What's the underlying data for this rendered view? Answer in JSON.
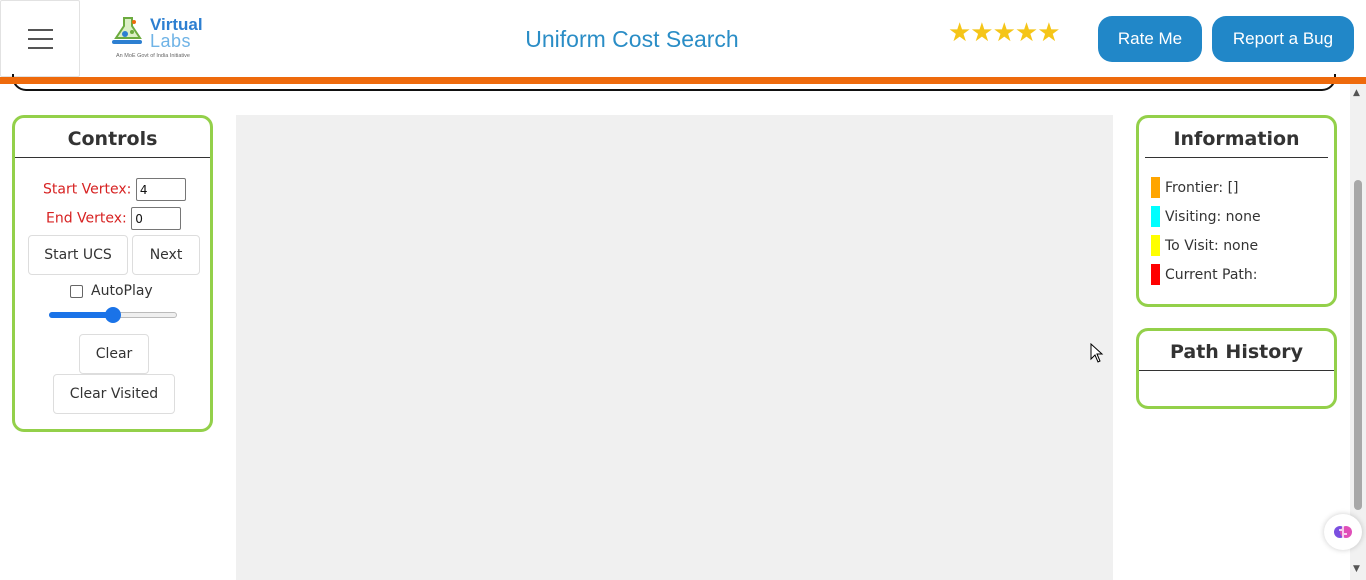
{
  "header": {
    "logo_text": "Virtual",
    "logo_text2": "Labs",
    "logo_tagline": "An MoE Govt of India Initiative",
    "title": "Uniform Cost Search",
    "stars": "★★★★★",
    "rate_label": "Rate Me",
    "bug_label": "Report a Bug"
  },
  "controls": {
    "title": "Controls",
    "start_label": "Start Vertex:",
    "start_value": "4",
    "end_label": "End Vertex:",
    "end_value": "0",
    "start_btn": "Start UCS",
    "next_btn": "Next",
    "autoplay_label": "AutoPlay",
    "autoplay_checked": false,
    "speed": 0.5,
    "clear_btn": "Clear",
    "clear_visited_btn": "Clear Visited"
  },
  "info": {
    "title": "Information",
    "legend": [
      {
        "color": "#ffa500",
        "label": "Frontier: []"
      },
      {
        "color": "#00ffff",
        "label": "Visiting: none"
      },
      {
        "color": "#ffff00",
        "label": "To Visit: none"
      },
      {
        "color": "#ff0000",
        "label": "Current Path:"
      }
    ]
  },
  "history": {
    "title": "Path History"
  },
  "colors": {
    "accent_orange": "#ee6a0c",
    "panel_border": "#93d04a",
    "button_blue": "#2187c8",
    "title_blue": "#2a8dc6",
    "label_red": "#d72222"
  }
}
